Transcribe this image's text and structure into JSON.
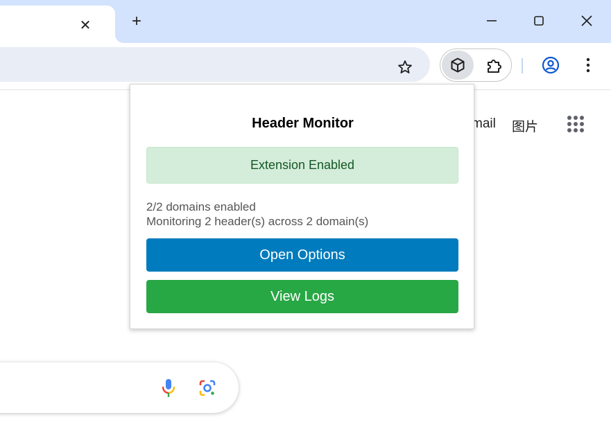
{
  "tab": {
    "close_glyph": "✕"
  },
  "new_tab_glyph": "+",
  "toolbar": {
    "star_icon": "star-icon",
    "extension_icon": "cube-icon",
    "extensions_menu_icon": "puzzle-icon",
    "profile_icon": "account-circle-icon",
    "menu_icon": "more-vert-icon"
  },
  "page": {
    "links": [
      "mail",
      "图片"
    ]
  },
  "popup": {
    "title": "Header Monitor",
    "status": "Extension Enabled",
    "domains_line": "2/2 domains enabled",
    "monitoring_line": "Monitoring 2 header(s) across 2 domain(s)",
    "open_options_label": "Open Options",
    "view_logs_label": "View Logs"
  },
  "colors": {
    "tabstrip_bg": "#d3e3fd",
    "status_bg": "#d4edda",
    "status_text": "#155724",
    "options_button": "#007bbd",
    "logs_button": "#28a745"
  }
}
